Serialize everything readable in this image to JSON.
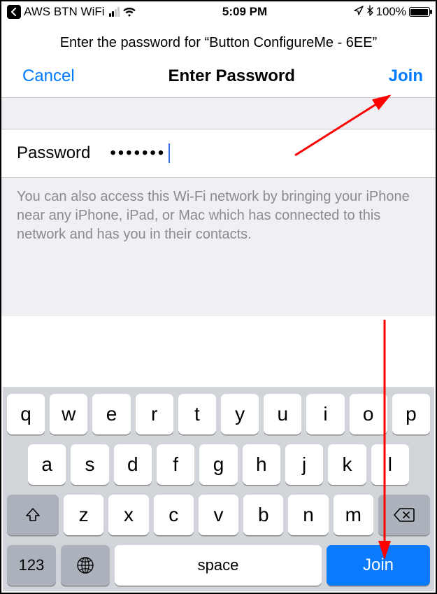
{
  "status_bar": {
    "carrier": "AWS BTN WiFi",
    "time": "5:09 PM",
    "battery_pct": "100%"
  },
  "header": {
    "subtitle": "Enter the password for “Button ConfigureMe - 6EE”",
    "cancel": "Cancel",
    "title": "Enter Password",
    "join": "Join"
  },
  "password": {
    "label": "Password",
    "value_masked": "•••••••"
  },
  "help": "You can also access this Wi-Fi network by bringing your iPhone near any iPhone, iPad, or Mac which has connected to this network and has you in their contacts.",
  "keyboard": {
    "row1": [
      "q",
      "w",
      "e",
      "r",
      "t",
      "y",
      "u",
      "i",
      "o",
      "p"
    ],
    "row2": [
      "a",
      "s",
      "d",
      "f",
      "g",
      "h",
      "j",
      "k",
      "l"
    ],
    "row3": [
      "z",
      "x",
      "c",
      "v",
      "b",
      "n",
      "m"
    ],
    "numbers": "123",
    "space": "space",
    "join": "Join"
  }
}
